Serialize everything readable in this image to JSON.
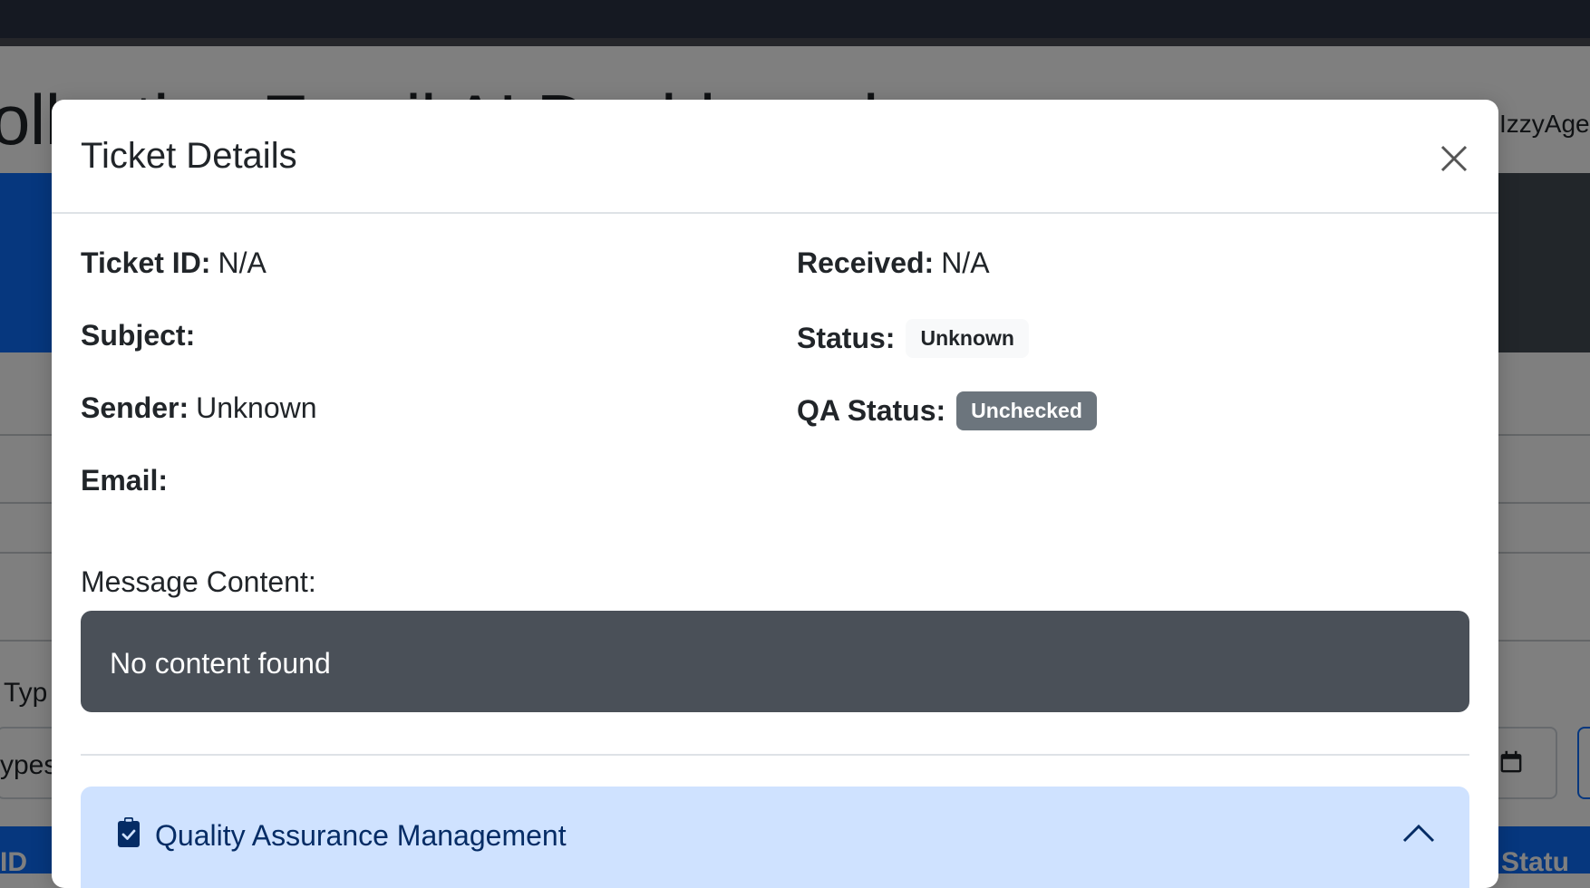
{
  "background": {
    "page_title": "ollective Email AI Dashboard",
    "user_name": "IzzyAge",
    "filter_label": "Typ",
    "filter_select_value": "ypes",
    "table_header_left": "ID",
    "table_header_right": "Statu"
  },
  "modal": {
    "title": "Ticket Details",
    "fields_left": [
      {
        "label": "Ticket ID:",
        "value": "N/A"
      },
      {
        "label": "Subject:",
        "value": ""
      },
      {
        "label": "Sender:",
        "value": "Unknown"
      },
      {
        "label": "Email:",
        "value": ""
      }
    ],
    "received": {
      "label": "Received:",
      "value": "N/A"
    },
    "status": {
      "label": "Status:",
      "badge": "Unknown"
    },
    "qa_status": {
      "label": "QA Status:",
      "badge": "Unchecked"
    },
    "message_label": "Message Content:",
    "message_text": "No content found",
    "qa_section": {
      "label": "Quality Assurance Management",
      "icon": "clipboard-check-icon",
      "expanded": true
    }
  },
  "colors": {
    "primary": "#0d6efd",
    "message_bg": "#4a5058",
    "qa_bg": "#cfe2ff",
    "badge_secondary": "#6c757d"
  }
}
